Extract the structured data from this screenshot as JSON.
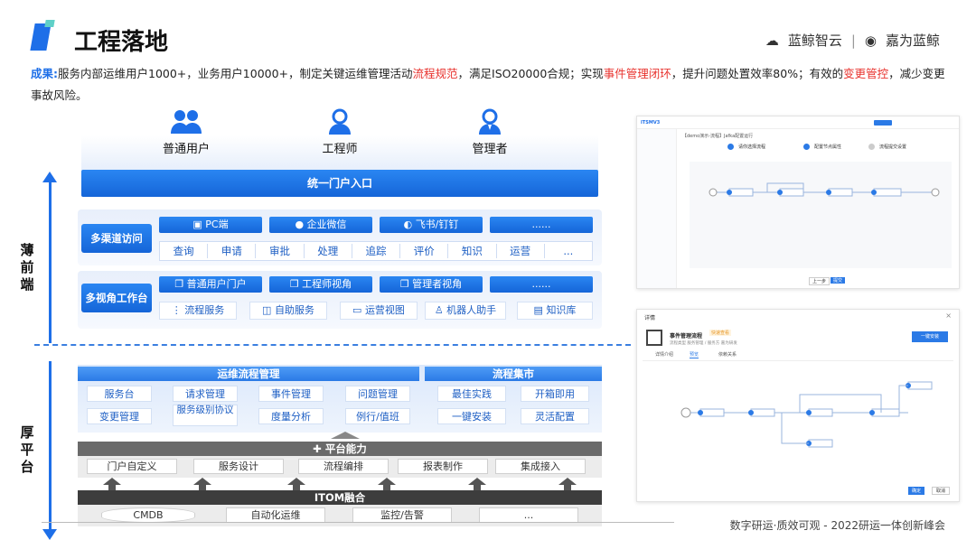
{
  "title": "工程落地",
  "logos": {
    "brand1": "蓝鲸智云",
    "sep": "|",
    "brand2": "嘉为蓝鲸"
  },
  "result": {
    "lead": "成果:",
    "t1": "服务内部运维用户1000+，业务用户10000+，制定关键运维管理活动",
    "r1": "流程规范",
    "t2": "，满足ISO20000合规；实现",
    "r2": "事件管理闭环",
    "t3": "，提升问题处置效率80%；有效的",
    "r3": "变更管控",
    "t4": "，减少变更事故风险。"
  },
  "rail": {
    "top_label": "薄前端",
    "bottom_label": "厚平台"
  },
  "users": [
    "普通用户",
    "工程师",
    "管理者"
  ],
  "portal": "统一门户入口",
  "multi_channel": {
    "label": "多渠道访问",
    "channels": [
      "PC端",
      "企业微信",
      "飞书/钉钉",
      "......"
    ],
    "actions": [
      "查询",
      "申请",
      "审批",
      "处理",
      "追踪",
      "评价",
      "知识",
      "运营",
      "..."
    ]
  },
  "multi_view": {
    "label": "多视角工作台",
    "views": [
      "普通用户门户",
      "工程师视角",
      "管理者视角",
      "......"
    ],
    "services": [
      "流程服务",
      "自助服务",
      "运营视图",
      "机器人助手",
      "知识库"
    ]
  },
  "ops_flow": {
    "title": "运维流程管理",
    "items": [
      "服务台",
      "请求管理",
      "事件管理",
      "问题管理",
      "变更管理",
      "服务级别协议",
      "度量分析",
      "例行/值班"
    ]
  },
  "flow_market": {
    "title": "流程集市",
    "items": [
      "最佳实践",
      "开箱即用",
      "一键安装",
      "灵活配置"
    ]
  },
  "platform": {
    "title": "平台能力",
    "items": [
      "门户自定义",
      "服务设计",
      "流程编排",
      "报表制作",
      "集成接入"
    ]
  },
  "itom": {
    "title": "ITOM融合",
    "items": [
      "CMDB",
      "自动化运维",
      "监控/告警",
      "..."
    ]
  },
  "shot1": {
    "app": "ITSMV3",
    "breadcrumb": "【demo演示-流程】Jafka配置运行",
    "step1": "请你选择流程",
    "step2": "配置节点属性",
    "step3": "流程提交设置",
    "btn_prev": "上一步",
    "btn_next": "提交"
  },
  "shot2": {
    "header": "详情",
    "name": "事件管理流程",
    "tag": "快速查看",
    "meta": "流程类型 服务管理 / 服务方 嘉为研发",
    "action": "一键安装",
    "tabs": [
      "详情介绍",
      "预览",
      "依赖关系"
    ],
    "confirm": "确定",
    "cancel": "取消"
  },
  "footer": "数字研运·质效可观 - 2022研运一体创新峰会"
}
